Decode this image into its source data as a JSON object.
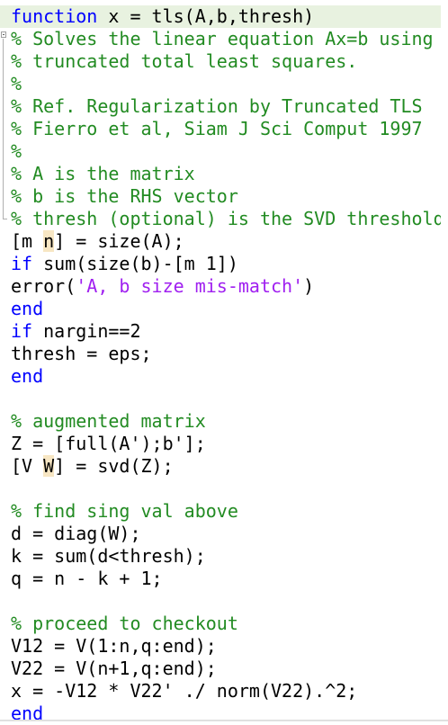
{
  "editor": {
    "lines": [
      {
        "kind": "function-sig",
        "kw": "function",
        "rest": " x = tls(A,b,thresh)"
      },
      {
        "kind": "comment",
        "text": "% Solves the linear equation Ax=b using"
      },
      {
        "kind": "comment",
        "text": "% truncated total least squares."
      },
      {
        "kind": "comment",
        "text": "%"
      },
      {
        "kind": "comment",
        "text": "% Ref. Regularization by Truncated TLS"
      },
      {
        "kind": "comment",
        "text": "% Fierro et al, Siam J Sci Comput 1997"
      },
      {
        "kind": "comment",
        "text": "%"
      },
      {
        "kind": "comment",
        "text": "% A is the matrix"
      },
      {
        "kind": "comment",
        "text": "% b is the RHS vector"
      },
      {
        "kind": "comment",
        "text": "% thresh (optional) is the SVD threshold"
      },
      {
        "kind": "size-line",
        "pre": "[m ",
        "hl": "n",
        "post": "] = size(A);"
      },
      {
        "kind": "kw-line",
        "kw": "if",
        "rest": " sum(size(b)-[m 1])"
      },
      {
        "kind": "string-line",
        "pre": "error(",
        "str": "'A, b size mis-match'",
        "post": ")"
      },
      {
        "kind": "kw-only",
        "kw": "end"
      },
      {
        "kind": "kw-line",
        "kw": "if",
        "rest": " nargin==2"
      },
      {
        "kind": "plain",
        "text": "thresh = eps;"
      },
      {
        "kind": "kw-only",
        "kw": "end"
      },
      {
        "kind": "blank",
        "text": ""
      },
      {
        "kind": "comment",
        "text": "% augmented matrix"
      },
      {
        "kind": "plain",
        "text": "Z = [full(A');b'];"
      },
      {
        "kind": "size-line",
        "pre": "[V ",
        "hl": "W",
        "post": "] = svd(Z);"
      },
      {
        "kind": "blank",
        "text": ""
      },
      {
        "kind": "comment",
        "text": "% find sing val above"
      },
      {
        "kind": "plain",
        "text": "d = diag(W);"
      },
      {
        "kind": "plain",
        "text": "k = sum(d<thresh);"
      },
      {
        "kind": "plain",
        "text": "q = n - k + 1;"
      },
      {
        "kind": "blank",
        "text": ""
      },
      {
        "kind": "comment",
        "text": "% proceed to checkout"
      },
      {
        "kind": "plain",
        "text": "V12 = V(1:n,q:end);"
      },
      {
        "kind": "plain",
        "text": "V22 = V(n+1,q:end);"
      },
      {
        "kind": "plain",
        "text": "x = -V12 * V22' ./ norm(V22).^2;"
      },
      {
        "kind": "kw-only",
        "kw": "end"
      }
    ]
  },
  "colors": {
    "keyword": "#0000ff",
    "comment": "#228b22",
    "string": "#a020f0",
    "current_line": "#e8f2e0",
    "variable_highlight": "#f7e6c3"
  }
}
